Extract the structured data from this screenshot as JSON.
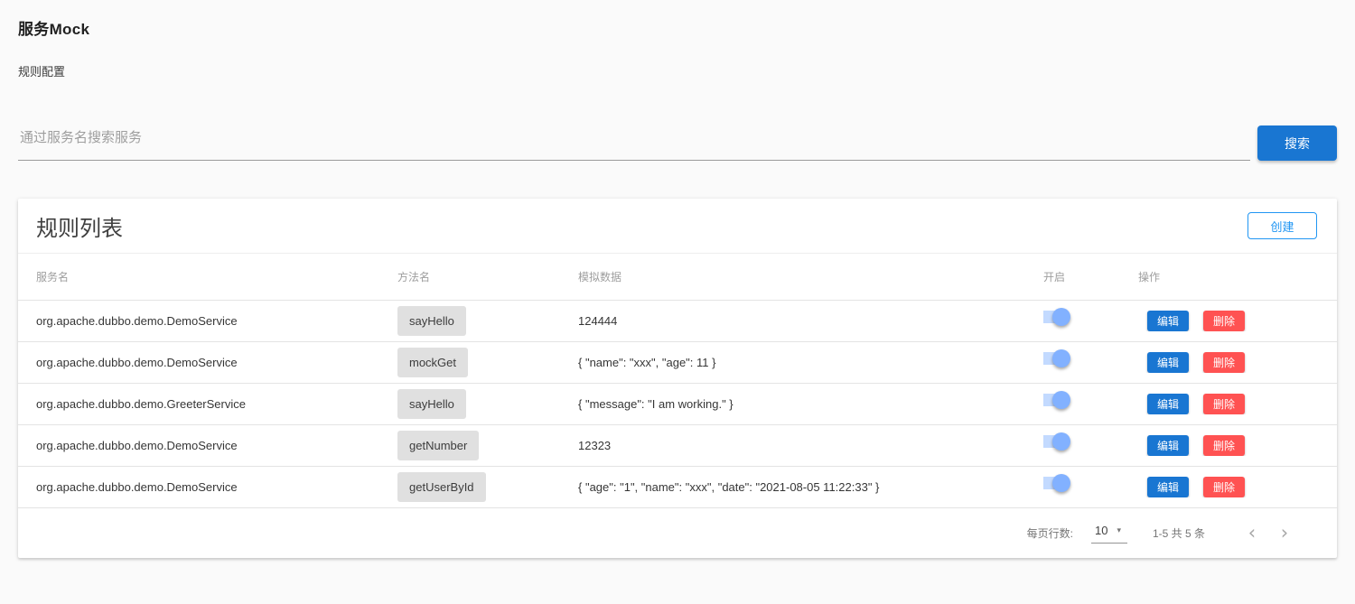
{
  "page": {
    "title": "服务Mock",
    "subtitle": "规则配置"
  },
  "search": {
    "placeholder": "通过服务名搜索服务",
    "button_label": "搜索"
  },
  "card": {
    "title": "规则列表",
    "create_label": "创建"
  },
  "table": {
    "headers": {
      "service": "服务名",
      "method": "方法名",
      "mock": "模拟数据",
      "enabled": "开启",
      "actions": "操作"
    },
    "edit_label": "编辑",
    "delete_label": "删除",
    "rows": [
      {
        "service": "org.apache.dubbo.demo.DemoService",
        "method": "sayHello",
        "mock": "124444",
        "enabled": true
      },
      {
        "service": "org.apache.dubbo.demo.DemoService",
        "method": "mockGet",
        "mock": "{ \"name\": \"xxx\", \"age\": 11 }",
        "enabled": true
      },
      {
        "service": "org.apache.dubbo.demo.GreeterService",
        "method": "sayHello",
        "mock": "{ \"message\": \"I am working.\" }",
        "enabled": true
      },
      {
        "service": "org.apache.dubbo.demo.DemoService",
        "method": "getNumber",
        "mock": "12323",
        "enabled": true
      },
      {
        "service": "org.apache.dubbo.demo.DemoService",
        "method": "getUserById",
        "mock": "{ \"age\": \"1\", \"name\": \"xxx\", \"date\": \"2021-08-05 11:22:33\" }",
        "enabled": true
      }
    ]
  },
  "pagination": {
    "rows_per_page_label": "每页行数:",
    "rows_per_page_value": "10",
    "caret_icon": "▾",
    "range_text": "1-5 共 5 条",
    "prev_icon": "‹",
    "next_icon": "›"
  },
  "colors": {
    "primary": "#1976d2",
    "create_outline": "#2196f3",
    "delete": "#ff5252",
    "switch_on": "#82b1ff",
    "page_background": "#fafafa"
  }
}
